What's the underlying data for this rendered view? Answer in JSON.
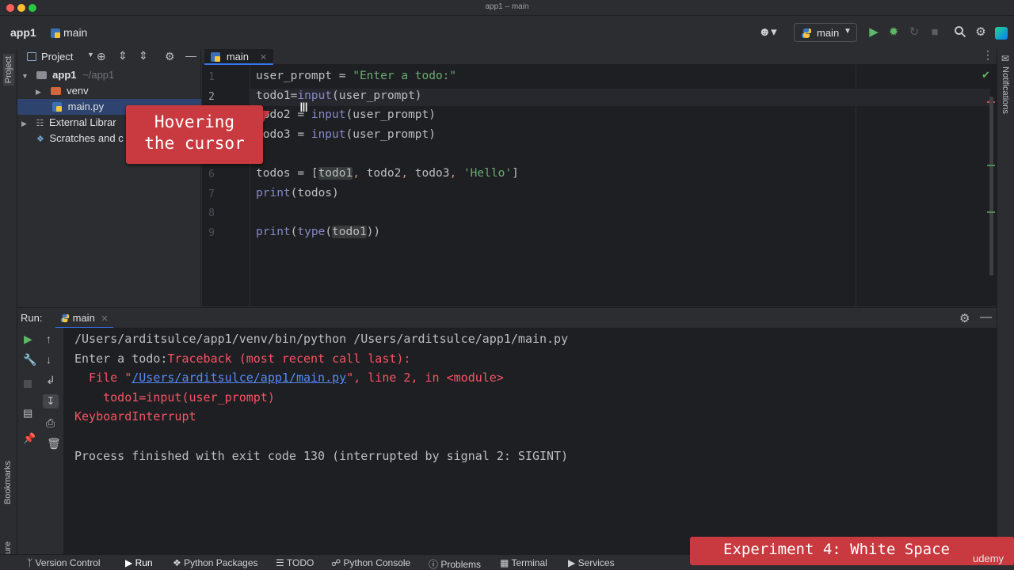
{
  "window": {
    "title": "app1 – main"
  },
  "toolbar": {
    "breadcrumb_project": "app1",
    "breadcrumb_file": "main",
    "run_config": "main"
  },
  "left_stripe": {
    "project_label": "Project",
    "bookmarks_label": "Bookmarks",
    "structure_label": "Structure"
  },
  "right_stripe": {
    "notifications_label": "Notifications"
  },
  "project_panel": {
    "title": "Project",
    "root_name": "app1",
    "root_path": "~/app1",
    "items": [
      {
        "label": "venv"
      },
      {
        "label": "main.py"
      },
      {
        "label": "External Librar"
      },
      {
        "label": "Scratches and c"
      }
    ]
  },
  "editor": {
    "tab_label": "main",
    "line_numbers": [
      "1",
      "2",
      "",
      "",
      "",
      "6",
      "7",
      "8",
      "9"
    ],
    "lines": {
      "l1_a": "user_prompt = ",
      "l1_b": "\"Enter a todo:\"",
      "l2_a": "todo1=",
      "l2_b": "input",
      "l2_c": "(user_prompt)",
      "l3_a": "todo2 = ",
      "l3_b": "input",
      "l3_c": "(user_prompt)",
      "l4_a": "todo3 = ",
      "l4_b": "input",
      "l4_c": "(user_prompt)",
      "l6_a": "todos = [",
      "l6_v1": "todo1",
      "l6_c1": ", ",
      "l6_v2": "todo2",
      "l6_c2": ", ",
      "l6_v3": "todo3",
      "l6_c3": ", ",
      "l6_s": "'Hello'",
      "l6_e": "]",
      "l7_a": "print",
      "l7_b": "(todos)",
      "l9_a": "print",
      "l9_b": "(",
      "l9_c": "type",
      "l9_d": "(",
      "l9_v": "todo1",
      "l9_e": "))"
    }
  },
  "run_panel": {
    "label": "Run:",
    "tab_label": "main",
    "console": {
      "line1": "/Users/arditsulce/app1/venv/bin/python /Users/arditsulce/app1/main.py",
      "line2_prompt": "Enter a todo:",
      "line2_err": "Traceback (most recent call last):",
      "line3_pre": "  File \"",
      "line3_link": "/Users/arditsulce/app1/main.py",
      "line3_post": "\", line 2, in <module>",
      "line4": "    todo1=input(user_prompt)",
      "line5": "KeyboardInterrupt",
      "line6": "Process finished with exit code 130 (interrupted by signal 2: SIGINT)"
    }
  },
  "statusbar": {
    "items": [
      "Version Control",
      "Run",
      "Python Packages",
      "TODO",
      "Python Console",
      "Problems",
      "Terminal",
      "Services"
    ]
  },
  "overlays": {
    "callout_line1": "Hovering",
    "callout_line2": "the cursor",
    "experiment_label": "Experiment 4: White Space",
    "watermark": "udemy"
  },
  "colors": {
    "accent": "#3574f0",
    "callout": "#c83a3f",
    "error": "#f75464",
    "string": "#6aab73",
    "run_green": "#5fb865"
  }
}
